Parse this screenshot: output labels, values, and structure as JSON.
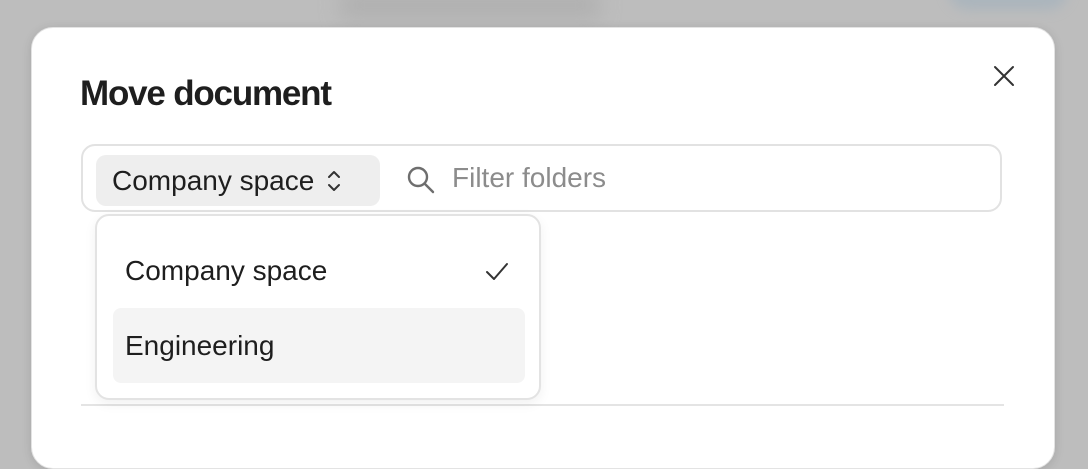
{
  "dialog": {
    "title": "Move document"
  },
  "space_selector": {
    "selected": "Company space"
  },
  "filter": {
    "placeholder": "Filter folders",
    "value": ""
  },
  "dropdown": {
    "options": [
      {
        "label": "Company space",
        "selected": true
      },
      {
        "label": "Engineering",
        "selected": false,
        "hovered": true
      }
    ]
  },
  "icons": {
    "close": "close-icon",
    "chevron": "chevron-up-down-icon",
    "search": "search-icon",
    "check": "check-icon"
  },
  "colors": {
    "hover_bg": "#f4f4f4",
    "select_bg": "#eeeeee",
    "border": "#e2e2e2",
    "placeholder": "#8c8c8c"
  }
}
